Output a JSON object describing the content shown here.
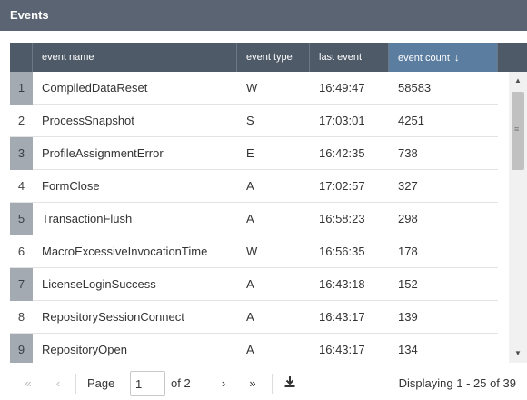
{
  "window": {
    "title": "Events"
  },
  "grid": {
    "columns": {
      "event_name": "event name",
      "event_type": "event type",
      "last_event": "last event",
      "event_count": "event count"
    },
    "rows": [
      {
        "num": "1",
        "name": "CompiledDataReset",
        "type": "W",
        "last": "16:49:47",
        "count": "58583"
      },
      {
        "num": "2",
        "name": "ProcessSnapshot",
        "type": "S",
        "last": "17:03:01",
        "count": "4251"
      },
      {
        "num": "3",
        "name": "ProfileAssignmentError",
        "type": "E",
        "last": "16:42:35",
        "count": "738"
      },
      {
        "num": "4",
        "name": "FormClose",
        "type": "A",
        "last": "17:02:57",
        "count": "327"
      },
      {
        "num": "5",
        "name": "TransactionFlush",
        "type": "A",
        "last": "16:58:23",
        "count": "298"
      },
      {
        "num": "6",
        "name": "MacroExcessiveInvocationTime",
        "type": "W",
        "last": "16:56:35",
        "count": "178"
      },
      {
        "num": "7",
        "name": "LicenseLoginSuccess",
        "type": "A",
        "last": "16:43:18",
        "count": "152"
      },
      {
        "num": "8",
        "name": "RepositorySessionConnect",
        "type": "A",
        "last": "16:43:17",
        "count": "139"
      },
      {
        "num": "9",
        "name": "RepositoryOpen",
        "type": "A",
        "last": "16:43:17",
        "count": "134"
      }
    ]
  },
  "pager": {
    "page_label": "Page",
    "current_page": "1",
    "of_label": "of 2",
    "display_text": "Displaying 1 - 25 of 39"
  }
}
